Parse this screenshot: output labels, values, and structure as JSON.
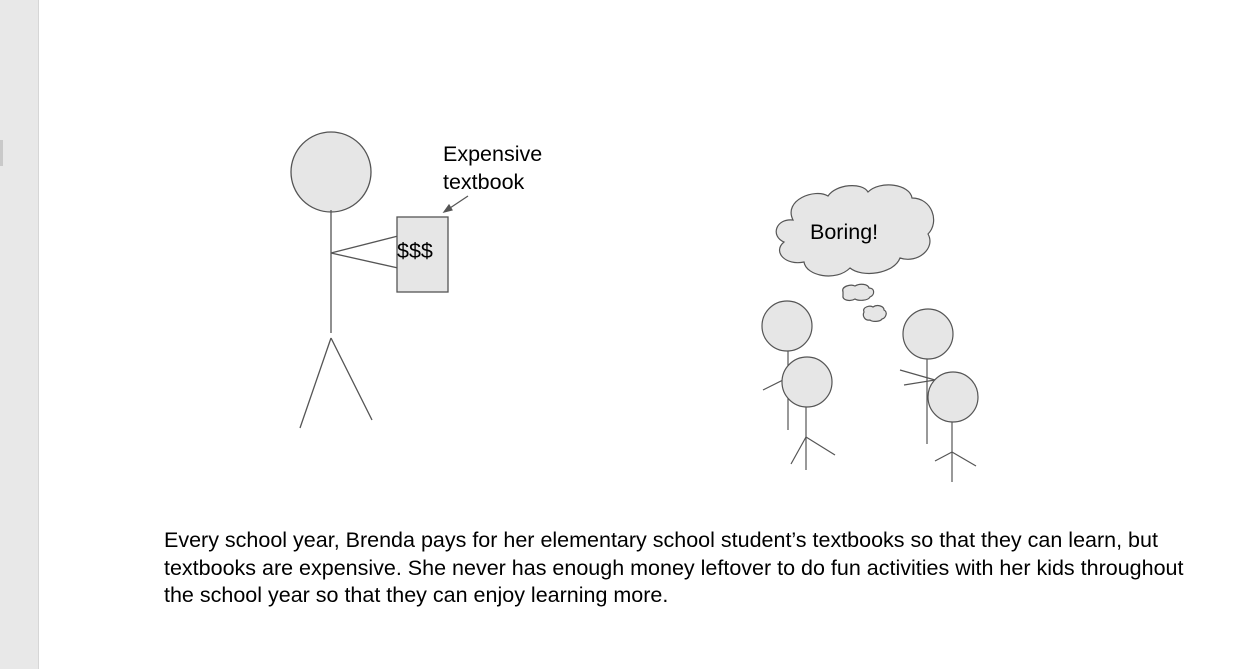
{
  "document": {
    "labels": {
      "textbook_label_line1": "Expensive",
      "textbook_label_line2": "textbook",
      "textbook_price": "$$$",
      "thought_text": "Boring!"
    },
    "paragraph": "Every school year, Brenda pays for her elementary school student’s textbooks so that they can learn, but textbooks are expensive. She never has enough money leftover to do fun activities with her kids throughout the school year so that they can enjoy learning more."
  },
  "colors": {
    "shape_fill": "#e6e6e6",
    "stroke": "#555555",
    "gutter": "#e8e8e8"
  }
}
